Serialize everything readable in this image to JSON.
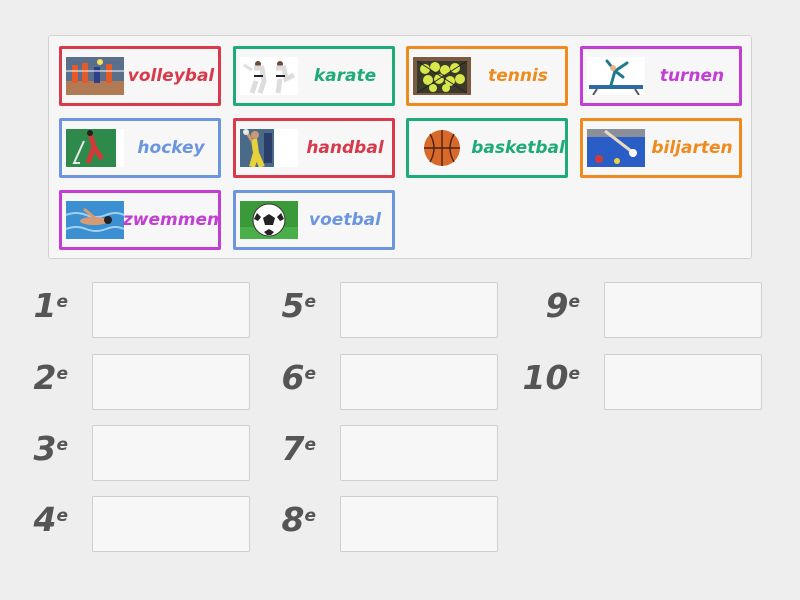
{
  "colors": {
    "red": "#d8394b",
    "green": "#1dab78",
    "orange": "#f08a1c",
    "purple": "#c23ed4",
    "blue": "#6b95de"
  },
  "tiles": [
    {
      "label": "volleybal",
      "color": "#d8394b",
      "icon": "volleyball-photo-icon"
    },
    {
      "label": "karate",
      "color": "#1dab78",
      "icon": "karate-photo-icon"
    },
    {
      "label": "tennis",
      "color": "#f08a1c",
      "icon": "tennis-balls-photo-icon"
    },
    {
      "label": "turnen",
      "color": "#c23ed4",
      "icon": "gymnast-beam-icon"
    },
    {
      "label": "hockey",
      "color": "#6b95de",
      "icon": "hockey-photo-icon"
    },
    {
      "label": "handbal",
      "color": "#d8394b",
      "icon": "handball-photo-icon"
    },
    {
      "label": "basketbal",
      "color": "#1dab78",
      "icon": "basketball-icon"
    },
    {
      "label": "biljarten",
      "color": "#f08a1c",
      "icon": "billiards-photo-icon"
    },
    {
      "label": "zwemmen",
      "color": "#c23ed4",
      "icon": "swimming-photo-icon"
    },
    {
      "label": "voetbal",
      "color": "#6b95de",
      "icon": "football-icon"
    }
  ],
  "slots": [
    {
      "num": "1",
      "suffix": "e"
    },
    {
      "num": "2",
      "suffix": "e"
    },
    {
      "num": "3",
      "suffix": "e"
    },
    {
      "num": "4",
      "suffix": "e"
    },
    {
      "num": "5",
      "suffix": "e"
    },
    {
      "num": "6",
      "suffix": "e"
    },
    {
      "num": "7",
      "suffix": "e"
    },
    {
      "num": "8",
      "suffix": "e"
    },
    {
      "num": "9",
      "suffix": "e"
    },
    {
      "num": "10",
      "suffix": "e"
    }
  ]
}
